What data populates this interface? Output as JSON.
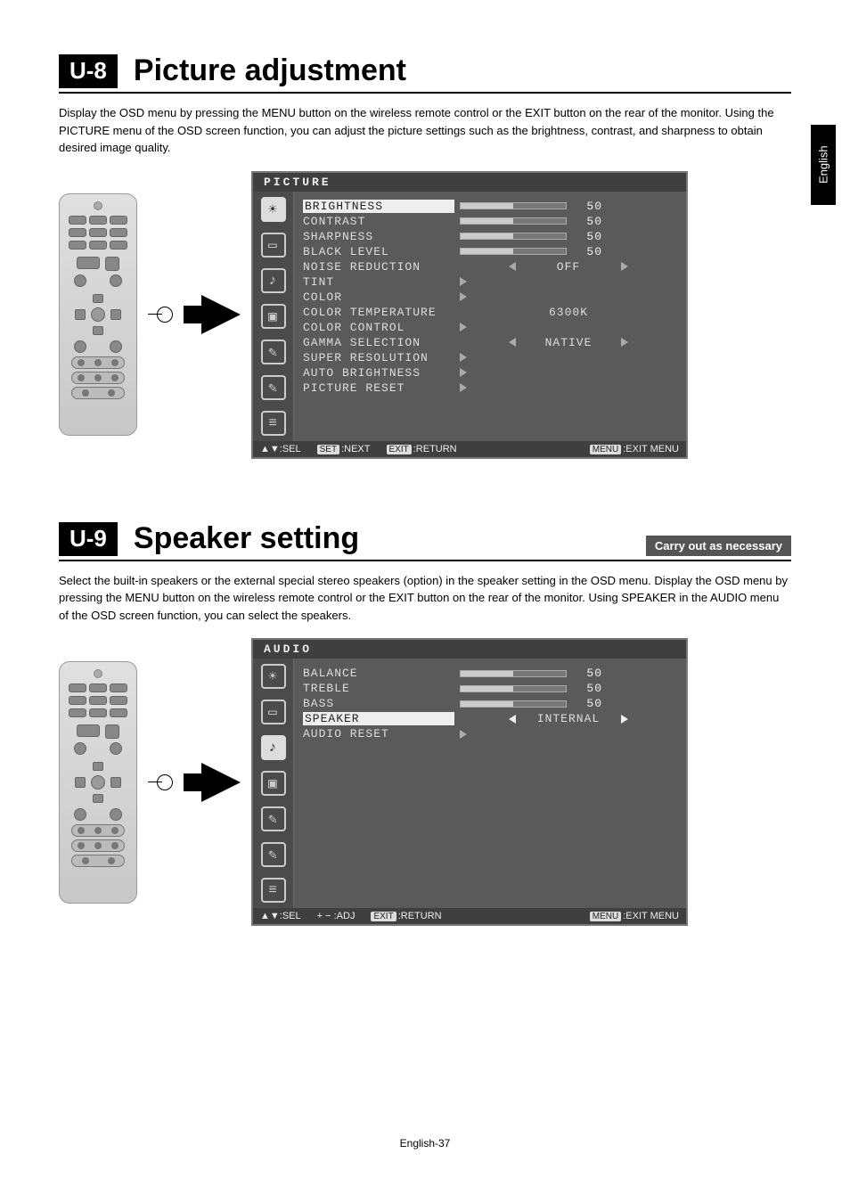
{
  "sideTab": "English",
  "section1": {
    "chip": "U-8",
    "title": "Picture adjustment",
    "body": "Display the OSD menu by pressing the MENU button on the wireless remote control or the EXIT button on the rear of the monitor. Using the PICTURE menu of the OSD screen function, you can adjust the picture settings such as the brightness, contrast, and sharpness to obtain desired image quality."
  },
  "osd1": {
    "title": "PICTURE",
    "rows": [
      {
        "label": "BRIGHTNESS",
        "type": "slider",
        "value": 50,
        "hilite": true
      },
      {
        "label": "CONTRAST",
        "type": "slider",
        "value": 50
      },
      {
        "label": "SHARPNESS",
        "type": "slider",
        "value": 50
      },
      {
        "label": "BLACK LEVEL",
        "type": "slider",
        "value": 50
      },
      {
        "label": "NOISE REDUCTION",
        "type": "option",
        "value": "OFF",
        "arrows": "both"
      },
      {
        "label": "TINT",
        "type": "sub"
      },
      {
        "label": "COLOR",
        "type": "sub"
      },
      {
        "label": "COLOR TEMPERATURE",
        "type": "option",
        "value": "6300K",
        "arrows": "none"
      },
      {
        "label": "COLOR CONTROL",
        "type": "sub"
      },
      {
        "label": "GAMMA SELECTION",
        "type": "option",
        "value": "NATIVE",
        "arrows": "both"
      },
      {
        "label": "SUPER RESOLUTION",
        "type": "sub"
      },
      {
        "label": "AUTO BRIGHTNESS",
        "type": "sub"
      },
      {
        "label": "PICTURE RESET",
        "type": "sub"
      }
    ],
    "footer": {
      "sel": "SEL",
      "next": "NEXT",
      "return": "RETURN",
      "exitmenu": "EXIT MENU",
      "setKey": "SET",
      "exitKey": "EXIT",
      "menuKey": "MENU"
    }
  },
  "section2": {
    "chip": "U-9",
    "title": "Speaker setting",
    "badge": "Carry out as necessary",
    "body": "Select the built-in speakers or the external special stereo speakers (option) in the speaker setting in the OSD menu. Display the OSD menu by pressing the MENU button on the wireless remote control or the EXIT button on the rear of the monitor. Using SPEAKER in the AUDIO menu of the OSD screen function, you can select the speakers."
  },
  "osd2": {
    "title": "AUDIO",
    "rows": [
      {
        "label": "BALANCE",
        "type": "slider",
        "value": 50
      },
      {
        "label": "TREBLE",
        "type": "slider",
        "value": 50
      },
      {
        "label": "BASS",
        "type": "slider",
        "value": 50
      },
      {
        "label": "SPEAKER",
        "type": "option",
        "value": "INTERNAL",
        "arrows": "both",
        "hilite": true
      },
      {
        "label": "AUDIO RESET",
        "type": "sub"
      }
    ],
    "footer": {
      "sel": "SEL",
      "adj": "ADJ",
      "return": "RETURN",
      "exitmenu": "EXIT MENU",
      "exitKey": "EXIT",
      "menuKey": "MENU"
    }
  },
  "pageFoot": "English-37"
}
